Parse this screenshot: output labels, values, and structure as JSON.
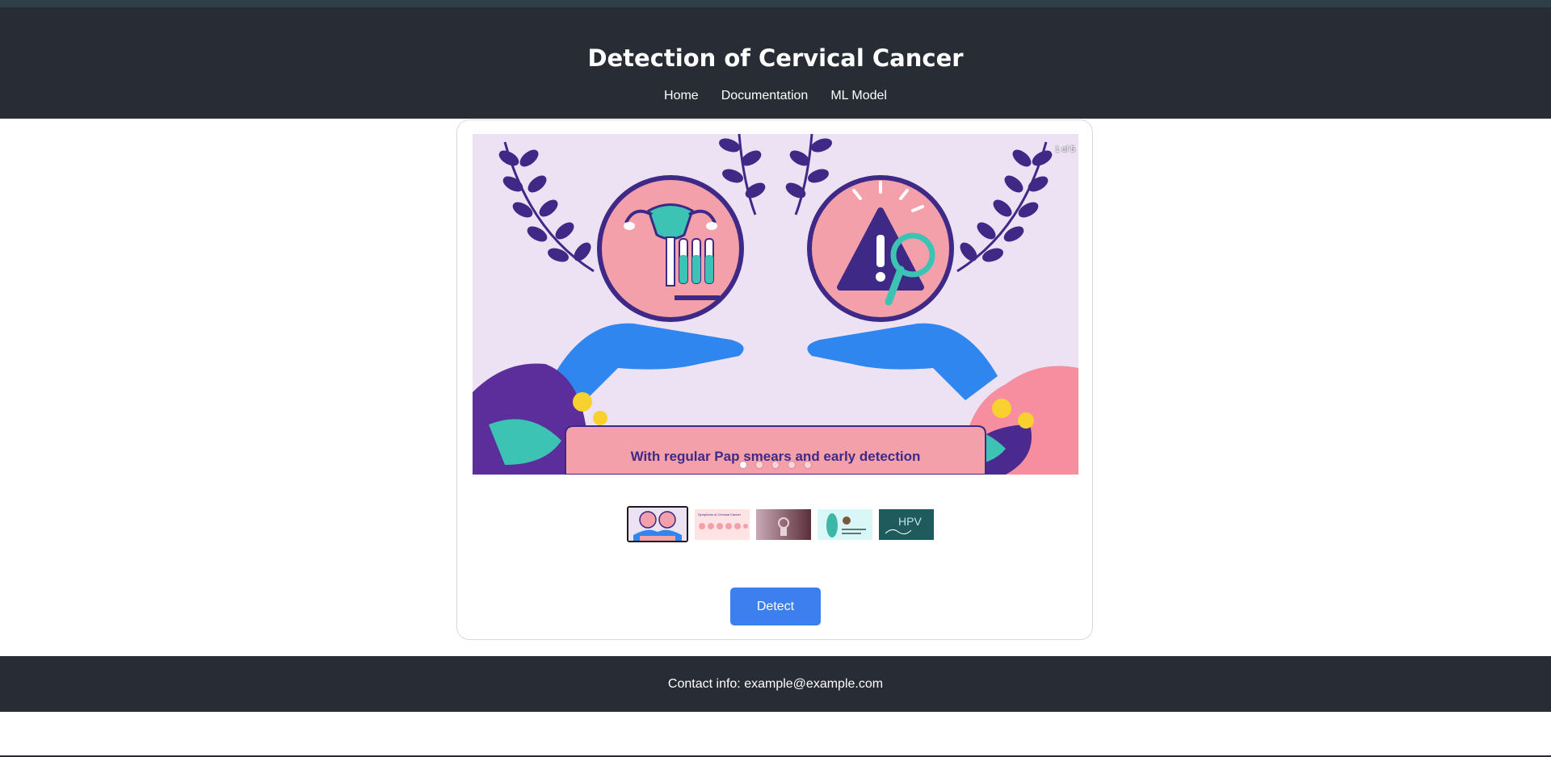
{
  "header": {
    "title": "Detection of Cervical Cancer",
    "nav": [
      "Home",
      "Documentation",
      "ML Model"
    ]
  },
  "carousel": {
    "counter": "1 of 5",
    "banner_text": "With regular Pap smears and early detection",
    "slide_count": 5,
    "active_index": 0
  },
  "thumbnails": [
    {
      "name": "thumbnail-1",
      "caption": ""
    },
    {
      "name": "thumbnail-2",
      "caption": "Symptoms of Cervical Cancer"
    },
    {
      "name": "thumbnail-3",
      "caption": ""
    },
    {
      "name": "thumbnail-4",
      "caption": ""
    },
    {
      "name": "thumbnail-5",
      "caption": "HPV"
    }
  ],
  "actions": {
    "detect_label": "Detect"
  },
  "footer": {
    "contact": "Contact info: example@example.com"
  },
  "colors": {
    "header_bg": "#282c34",
    "button": "#3d7fef",
    "slide_bg": "#ece2f4",
    "accent_purple": "#3e2a86",
    "accent_pink": "#f4a0aa",
    "accent_blue": "#2f86ee",
    "accent_teal": "#3cc3b3"
  }
}
